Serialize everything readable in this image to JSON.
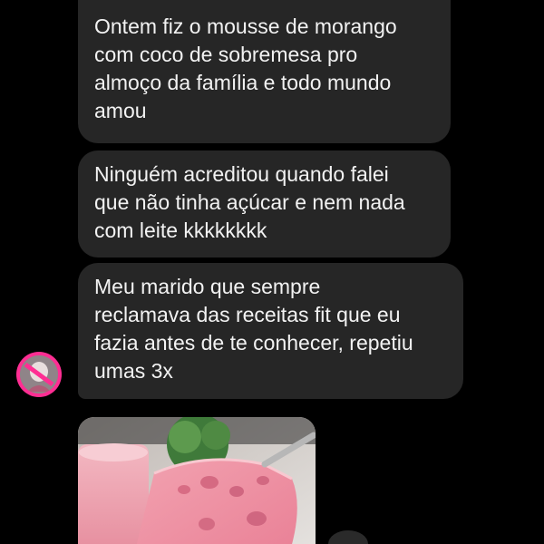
{
  "messages": [
    {
      "text": "Ontem fiz o mousse de morango\ncom coco de sobremesa pro\nalmoço da família e todo mundo\namou"
    },
    {
      "text": "Ninguém acreditou quando falei\nque não tinha açúcar e nem nada\ncom leite kkkkkkkk"
    },
    {
      "text": "Meu marido que sempre\nreclamava das receitas fit que eu\nfazia antes de te conhecer, repetiu\numas 3x"
    }
  ],
  "photo": {
    "subject": "strawberry mousse"
  },
  "colors": {
    "background": "#000000",
    "bubble": "#262626",
    "text": "#f2f2f2",
    "avatar_ring": "#ff2e93",
    "mousse": "#e68d9c"
  },
  "icons": [
    "avatar-icon"
  ]
}
